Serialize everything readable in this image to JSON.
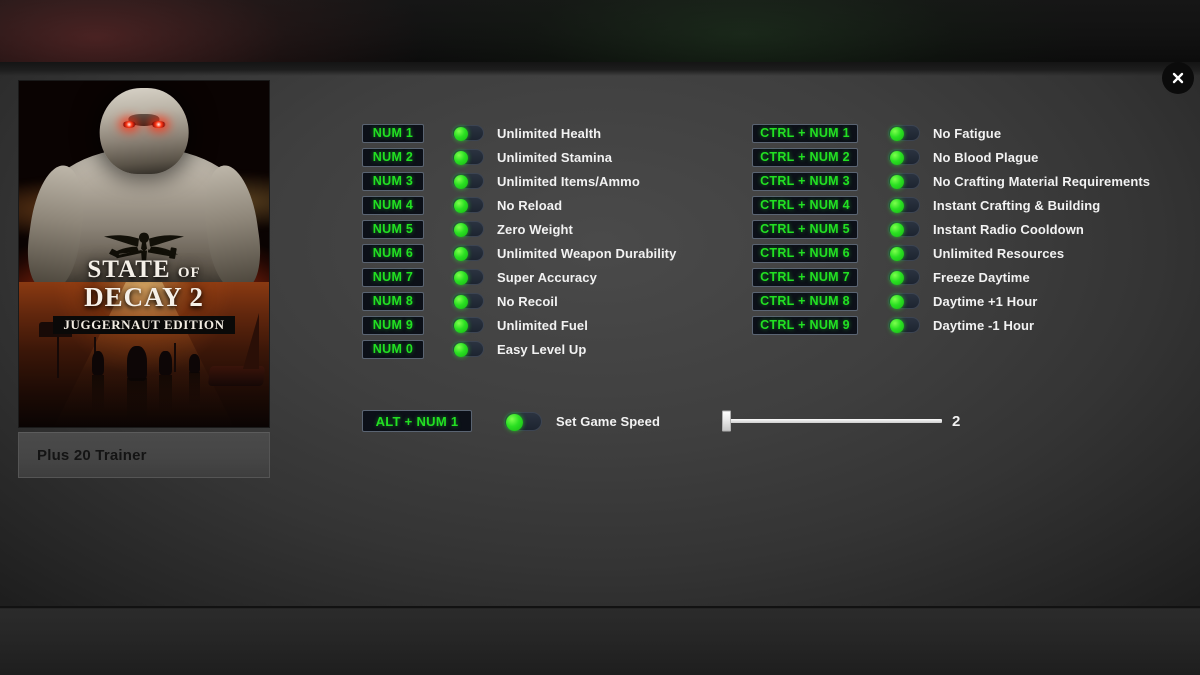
{
  "window": {
    "close_label": "×",
    "close_icon": "close-icon"
  },
  "game": {
    "cover_title_line1": "STATE",
    "cover_title_of": "OF",
    "cover_title_line2": "DECAY 2",
    "cover_edition": "JUGGERNAUT EDITION",
    "trainer_label": "Plus 20 Trainer"
  },
  "colors": {
    "hotkey_text": "#22e022",
    "toggle_knob": "#2ae022",
    "label_text": "#f2f2f2",
    "panel_bg": "#3f3f3f",
    "banner_bg": "#121212"
  },
  "cheats_left": [
    {
      "hotkey": "NUM 1",
      "label": "Unlimited Health",
      "enabled": false
    },
    {
      "hotkey": "NUM 2",
      "label": "Unlimited Stamina",
      "enabled": false
    },
    {
      "hotkey": "NUM 3",
      "label": "Unlimited  Items/Ammo",
      "enabled": false
    },
    {
      "hotkey": "NUM 4",
      "label": "No Reload",
      "enabled": false
    },
    {
      "hotkey": "NUM 5",
      "label": "Zero Weight",
      "enabled": false
    },
    {
      "hotkey": "NUM 6",
      "label": "Unlimited Weapon Durability",
      "enabled": false
    },
    {
      "hotkey": "NUM 7",
      "label": "Super Accuracy",
      "enabled": false
    },
    {
      "hotkey": "NUM 8",
      "label": "No Recoil",
      "enabled": false
    },
    {
      "hotkey": "NUM 9",
      "label": "Unlimited Fuel",
      "enabled": false
    },
    {
      "hotkey": "NUM 0",
      "label": "Easy Level Up",
      "enabled": false
    }
  ],
  "cheats_right": [
    {
      "hotkey": "CTRL + NUM 1",
      "label": "No Fatigue",
      "enabled": false
    },
    {
      "hotkey": "CTRL + NUM 2",
      "label": "No Blood Plague",
      "enabled": false
    },
    {
      "hotkey": "CTRL + NUM 3",
      "label": "No Crafting Material Requirements",
      "enabled": false
    },
    {
      "hotkey": "CTRL + NUM 4",
      "label": "Instant Crafting & Building",
      "enabled": false
    },
    {
      "hotkey": "CTRL + NUM 5",
      "label": "Instant Radio Cooldown",
      "enabled": false
    },
    {
      "hotkey": "CTRL + NUM 6",
      "label": "Unlimited Resources",
      "enabled": false
    },
    {
      "hotkey": "CTRL + NUM 7",
      "label": "Freeze Daytime",
      "enabled": false
    },
    {
      "hotkey": "CTRL + NUM 8",
      "label": "Daytime +1 Hour",
      "enabled": false
    },
    {
      "hotkey": "CTRL + NUM 9",
      "label": "Daytime -1 Hour",
      "enabled": false
    }
  ],
  "game_speed": {
    "hotkey": "ALT + NUM 1",
    "label": "Set Game Speed",
    "value": "2",
    "slider_percent": 0
  }
}
